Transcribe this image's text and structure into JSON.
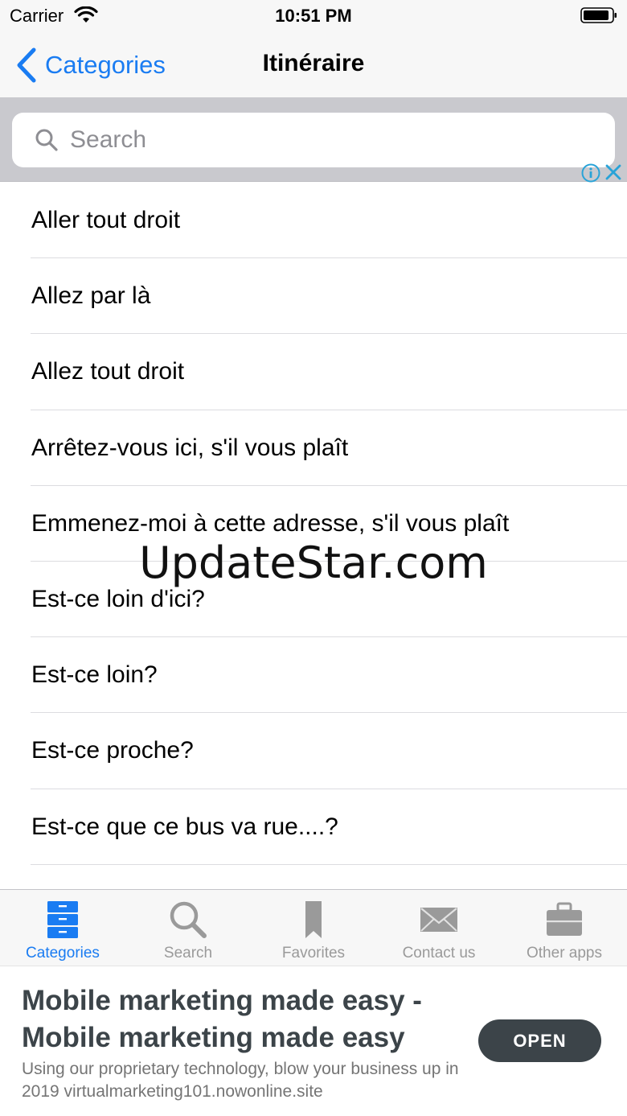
{
  "status_bar": {
    "carrier": "Carrier",
    "time": "10:51 PM"
  },
  "nav": {
    "back_label": "Categories",
    "title": "Itinéraire"
  },
  "search": {
    "placeholder": "Search",
    "value": ""
  },
  "phrases": [
    "Aller tout droit",
    "Allez par là",
    "Allez tout droit",
    "Arrêtez-vous ici, s'il vous plaît",
    "Emmenez-moi à cette adresse, s'il vous plaît",
    "Est-ce loin d'ici?",
    "Est-ce loin?",
    "Est-ce proche?",
    "Est-ce que ce bus va  rue....?"
  ],
  "watermark": "UpdateStar.com",
  "tabs": [
    {
      "label": "Categories",
      "icon": "cabinet-icon",
      "active": true
    },
    {
      "label": "Search",
      "icon": "magnifier-icon",
      "active": false
    },
    {
      "label": "Favorites",
      "icon": "bookmark-icon",
      "active": false
    },
    {
      "label": "Contact us",
      "icon": "envelope-icon",
      "active": false
    },
    {
      "label": "Other apps",
      "icon": "briefcase-icon",
      "active": false
    }
  ],
  "ad": {
    "headline": "Mobile marketing made easy - Mobile marketing made easy",
    "body": "Using our proprietary technology, blow your business up in 2019 virtualmarketing101.nowonline.site",
    "cta": "OPEN"
  },
  "colors": {
    "accent": "#1a7cf2",
    "tab_inactive": "#9a9a9a",
    "ad_button": "#3c4449"
  }
}
